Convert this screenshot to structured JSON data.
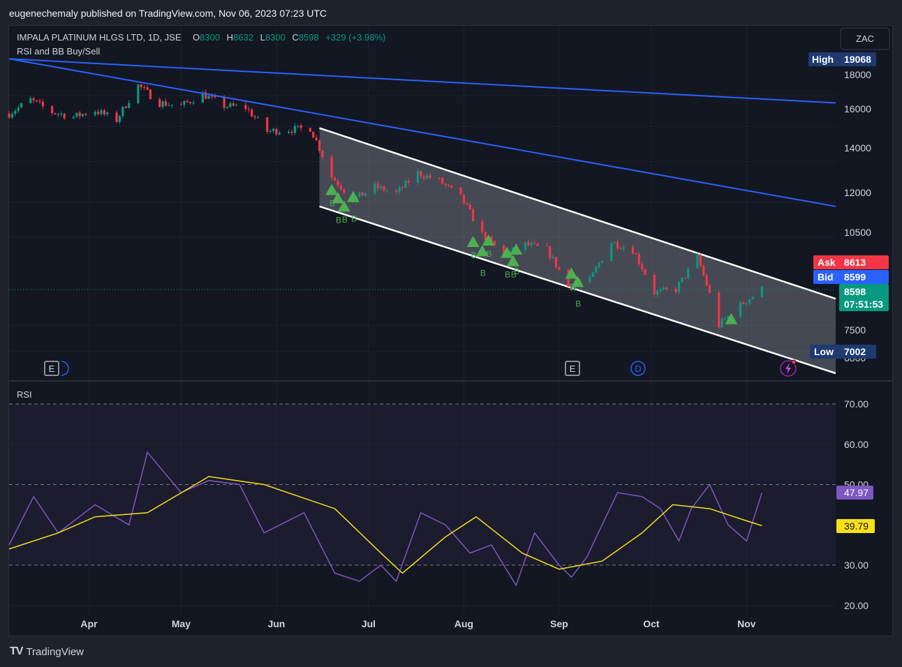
{
  "publisher_line": "eugenechemaly published on TradingView.com, Nov 06, 2023 07:23 UTC",
  "footer": {
    "logo_text": "TV",
    "brand": "TradingView"
  },
  "legend": {
    "symbol": "IMPALA PLATINUM HLGS LTD, 1D, JSE",
    "o_label": "O",
    "o_value": "8300",
    "h_label": "H",
    "h_value": "8632",
    "l_label": "L",
    "l_value": "8300",
    "c_label": "C",
    "c_value": "8598",
    "change": "+329 (+3.98%)",
    "indicator": "RSI and BB Buy/Sell"
  },
  "currency_button": "ZAC",
  "markers": {
    "high_label": "High",
    "high_value": "19068",
    "ask_label": "Ask",
    "ask_value": "8613",
    "bid_label": "Bid",
    "bid_value": "8599",
    "last_value": "8598",
    "countdown": "07:51:53",
    "low_label": "Low",
    "low_value": "7002"
  },
  "rsi_pane": {
    "title": "RSI",
    "rsi_value": "47.97",
    "ma_value": "39.79"
  },
  "event_badges": [
    "E",
    "E",
    "D"
  ],
  "colors": {
    "up": "#089981",
    "down": "#f23645",
    "trend": "#2962ff",
    "channel": "#ffffff",
    "rsi": "#7e57c2",
    "rsi_ma": "#f7e01a",
    "signal": "#4caf50",
    "ask": "#f23645",
    "bid": "#2962ff"
  },
  "chart_data": [
    {
      "type": "candlestick",
      "title": "IMPALA PLATINUM HLGS LTD, 1D, JSE",
      "x_ticks": [
        "Apr",
        "May",
        "Jun",
        "Jul",
        "Aug",
        "Sep",
        "Oct",
        "Nov"
      ],
      "y_ticks": [
        18000,
        16000,
        14000,
        12000,
        10500,
        7500,
        6800
      ],
      "y_scale": "log",
      "ylim": [
        6250,
        21500
      ],
      "start_date": "2023-03-06",
      "end_date": "2023-11-06",
      "close_series": [
        {
          "date": "2023-03-06",
          "close": 16800
        },
        {
          "date": "2023-03-13",
          "close": 17700
        },
        {
          "date": "2023-03-20",
          "close": 16900
        },
        {
          "date": "2023-03-27",
          "close": 16600
        },
        {
          "date": "2023-04-03",
          "close": 17000
        },
        {
          "date": "2023-04-10",
          "close": 16400
        },
        {
          "date": "2023-04-17",
          "close": 18700
        },
        {
          "date": "2023-04-24",
          "close": 17500
        },
        {
          "date": "2023-05-01",
          "close": 17300
        },
        {
          "date": "2023-05-08",
          "close": 18100
        },
        {
          "date": "2023-05-15",
          "close": 17300
        },
        {
          "date": "2023-05-22",
          "close": 17200
        },
        {
          "date": "2023-05-29",
          "close": 15700
        },
        {
          "date": "2023-06-05",
          "close": 15800
        },
        {
          "date": "2023-06-12",
          "close": 15900
        },
        {
          "date": "2023-06-19",
          "close": 13200
        },
        {
          "date": "2023-06-26",
          "close": 12100
        },
        {
          "date": "2023-07-03",
          "close": 12700
        },
        {
          "date": "2023-07-10",
          "close": 12400
        },
        {
          "date": "2023-07-17",
          "close": 13400
        },
        {
          "date": "2023-07-24",
          "close": 13000
        },
        {
          "date": "2023-07-31",
          "close": 12200
        },
        {
          "date": "2023-08-07",
          "close": 10600
        },
        {
          "date": "2023-08-14",
          "close": 9800
        },
        {
          "date": "2023-08-21",
          "close": 10200
        },
        {
          "date": "2023-08-28",
          "close": 10000
        },
        {
          "date": "2023-09-04",
          "close": 8700
        },
        {
          "date": "2023-09-11",
          "close": 8900
        },
        {
          "date": "2023-09-18",
          "close": 10300
        },
        {
          "date": "2023-09-25",
          "close": 10000
        },
        {
          "date": "2023-10-02",
          "close": 8500
        },
        {
          "date": "2023-10-09",
          "close": 8600
        },
        {
          "date": "2023-10-16",
          "close": 9700
        },
        {
          "date": "2023-10-23",
          "close": 7500
        },
        {
          "date": "2023-10-30",
          "close": 8100
        },
        {
          "date": "2023-11-06",
          "close": 8598
        }
      ],
      "trend_lines": [
        {
          "from": {
            "date": "2023-03-06",
            "value": 20700
          },
          "to": {
            "date": "2023-11-30",
            "value": 17500
          }
        },
        {
          "from": {
            "date": "2023-03-06",
            "value": 20700
          },
          "to": {
            "date": "2023-11-30",
            "value": 11800
          }
        }
      ],
      "channel": {
        "upper": {
          "from": {
            "date": "2023-06-15",
            "value": 15900
          },
          "to": {
            "date": "2023-11-30",
            "value": 8300
          }
        },
        "lower": {
          "from": {
            "date": "2023-06-15",
            "value": 11800
          },
          "to": {
            "date": "2023-11-30",
            "value": 6250
          }
        }
      },
      "buy_signals": [
        "2023-06-19",
        "2023-06-21",
        "2023-06-23",
        "2023-06-26",
        "2023-08-04",
        "2023-08-07",
        "2023-08-09",
        "2023-08-15",
        "2023-08-17",
        "2023-08-18",
        "2023-09-05",
        "2023-09-07",
        "2023-10-27"
      ],
      "buy_signal_label": "B"
    },
    {
      "type": "line",
      "title": "RSI",
      "y_ticks": [
        70,
        60,
        50,
        30,
        20
      ],
      "ylim": [
        18,
        73
      ],
      "bands": [
        30,
        50,
        70
      ],
      "series": [
        {
          "name": "RSI",
          "points": [
            {
              "date": "2023-03-06",
              "value": 35
            },
            {
              "date": "2023-03-14",
              "value": 47
            },
            {
              "date": "2023-03-22",
              "value": 38
            },
            {
              "date": "2023-04-03",
              "value": 45
            },
            {
              "date": "2023-04-14",
              "value": 40
            },
            {
              "date": "2023-04-20",
              "value": 58
            },
            {
              "date": "2023-05-01",
              "value": 48
            },
            {
              "date": "2023-05-10",
              "value": 51
            },
            {
              "date": "2023-05-20",
              "value": 50
            },
            {
              "date": "2023-05-28",
              "value": 38
            },
            {
              "date": "2023-06-10",
              "value": 43
            },
            {
              "date": "2023-06-20",
              "value": 28
            },
            {
              "date": "2023-06-28",
              "value": 26
            },
            {
              "date": "2023-07-05",
              "value": 30
            },
            {
              "date": "2023-07-10",
              "value": 26
            },
            {
              "date": "2023-07-18",
              "value": 43
            },
            {
              "date": "2023-07-26",
              "value": 40
            },
            {
              "date": "2023-08-03",
              "value": 33
            },
            {
              "date": "2023-08-10",
              "value": 35
            },
            {
              "date": "2023-08-18",
              "value": 25
            },
            {
              "date": "2023-08-24",
              "value": 38
            },
            {
              "date": "2023-09-01",
              "value": 30
            },
            {
              "date": "2023-09-05",
              "value": 27
            },
            {
              "date": "2023-09-10",
              "value": 32
            },
            {
              "date": "2023-09-20",
              "value": 48
            },
            {
              "date": "2023-09-28",
              "value": 47
            },
            {
              "date": "2023-10-04",
              "value": 44
            },
            {
              "date": "2023-10-10",
              "value": 36
            },
            {
              "date": "2023-10-14",
              "value": 44
            },
            {
              "date": "2023-10-20",
              "value": 50
            },
            {
              "date": "2023-10-26",
              "value": 40
            },
            {
              "date": "2023-11-01",
              "value": 36
            },
            {
              "date": "2023-11-06",
              "value": 47.97
            }
          ]
        },
        {
          "name": "RSI-based MA",
          "points": [
            {
              "date": "2023-03-06",
              "value": 34
            },
            {
              "date": "2023-03-22",
              "value": 38
            },
            {
              "date": "2023-04-03",
              "value": 42
            },
            {
              "date": "2023-04-20",
              "value": 43
            },
            {
              "date": "2023-05-10",
              "value": 52
            },
            {
              "date": "2023-05-28",
              "value": 50
            },
            {
              "date": "2023-06-20",
              "value": 44
            },
            {
              "date": "2023-07-05",
              "value": 33
            },
            {
              "date": "2023-07-12",
              "value": 28
            },
            {
              "date": "2023-07-26",
              "value": 37
            },
            {
              "date": "2023-08-05",
              "value": 42
            },
            {
              "date": "2023-08-20",
              "value": 33
            },
            {
              "date": "2023-09-01",
              "value": 29
            },
            {
              "date": "2023-09-15",
              "value": 31
            },
            {
              "date": "2023-09-28",
              "value": 38
            },
            {
              "date": "2023-10-08",
              "value": 45
            },
            {
              "date": "2023-10-20",
              "value": 44
            },
            {
              "date": "2023-11-01",
              "value": 41
            },
            {
              "date": "2023-11-06",
              "value": 39.79
            }
          ]
        }
      ]
    }
  ]
}
